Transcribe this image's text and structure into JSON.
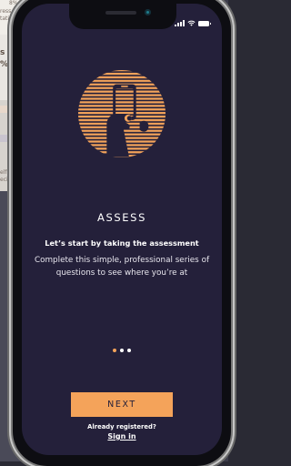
{
  "background_snippets": {
    "top": "8%",
    "line1": "ress",
    "line2": "tati",
    "line3": "s S",
    "line4": "% 1",
    "line5": "elf",
    "line6": "ecis"
  },
  "colors": {
    "screen_bg": "#24203a",
    "accent": "#f4a35a",
    "text": "#ffffff"
  },
  "onboarding": {
    "illustration": "person-holding-phone-icon",
    "title": "ASSESS",
    "subtitle": "Let’s start by taking the assessment",
    "body": "Complete this simple, professional series of questions to see where you’re at",
    "page_indicator": {
      "total": 3,
      "active": 1
    }
  },
  "actions": {
    "next_label": "NEXT",
    "already_registered": "Already registered?",
    "sign_in": "Sign in"
  }
}
